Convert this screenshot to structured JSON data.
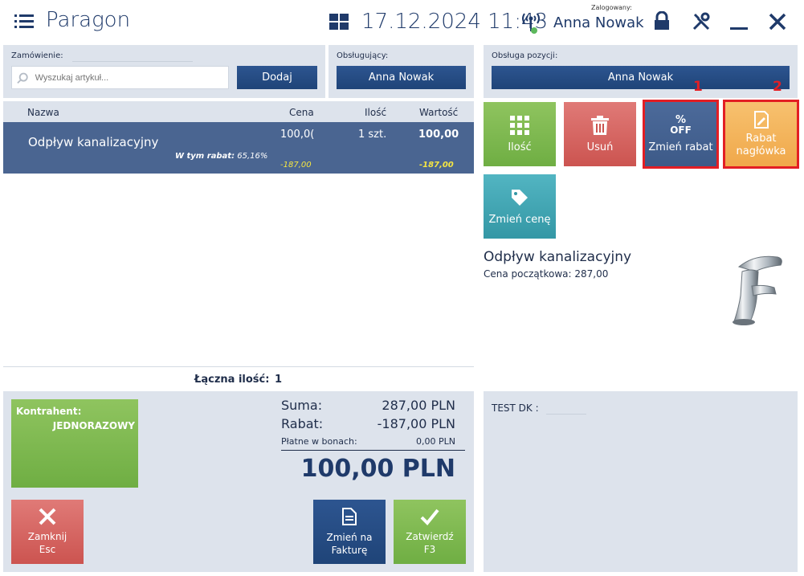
{
  "header": {
    "title": "Paragon",
    "datetime": "17.12.2024 11:43",
    "logged_label": "Zalogowany:",
    "user": "Anna Nowak"
  },
  "order": {
    "label": "Zamówienie:",
    "search_placeholder": "Wyszukaj artykuł...",
    "add_label": "Dodaj"
  },
  "server": {
    "label": "Obsługujący:",
    "value": "Anna Nowak"
  },
  "position_service": {
    "label": "Obsługa pozycji:",
    "value": "Anna Nowak"
  },
  "table": {
    "columns": [
      "Nazwa",
      "Cena",
      "Ilość",
      "Wartość"
    ],
    "rows": [
      {
        "name": "Odpływ kanalizacyjny",
        "price": "100,0(",
        "qty": "1 szt.",
        "value": "100,00",
        "discount_label": "W tym rabat:",
        "discount_pct": "65,16%",
        "price_discount": "-187,00",
        "value_discount": "-187,00"
      }
    ],
    "total_qty_label": "Łączna ilość:",
    "total_qty": "1"
  },
  "actions": {
    "qty": "Ilość",
    "delete": "Usuń",
    "discount_badge_top": "%",
    "discount_badge_bottom": "OFF",
    "change_discount": "Zmień rabat",
    "header_discount_line1": "Rabat",
    "header_discount_line2": "nagłówka",
    "change_price": "Zmień cenę",
    "callout_1": "1",
    "callout_2": "2"
  },
  "product": {
    "name": "Odpływ kanalizacyjny",
    "base_price_label": "Cena początkowa:",
    "base_price": "287,00"
  },
  "customer": {
    "label": "Kontrahent:",
    "value": "JEDNORAZOWY"
  },
  "summary": {
    "sum_label": "Suma:",
    "sum_value": "287,00 PLN",
    "discount_label": "Rabat:",
    "discount_value": "-187,00 PLN",
    "vouchers_label": "Płatne w bonach:",
    "vouchers_value": "0,00 PLN",
    "total": "100,00 PLN"
  },
  "bottom_buttons": {
    "close_line1": "Zamknij",
    "close_line2": "Esc",
    "invoice_line1": "Zmień na",
    "invoice_line2": "Fakturę",
    "confirm_line1": "Zatwierdź",
    "confirm_line2": "F3"
  },
  "attributes": {
    "test_dk_label": "TEST DK :"
  },
  "colors": {
    "navy": "#1f4478",
    "green": "#7bb84a",
    "red": "#d9534f",
    "orange": "#f0a84a",
    "teal": "#3aa2b0",
    "highlight": "#e31e24"
  }
}
